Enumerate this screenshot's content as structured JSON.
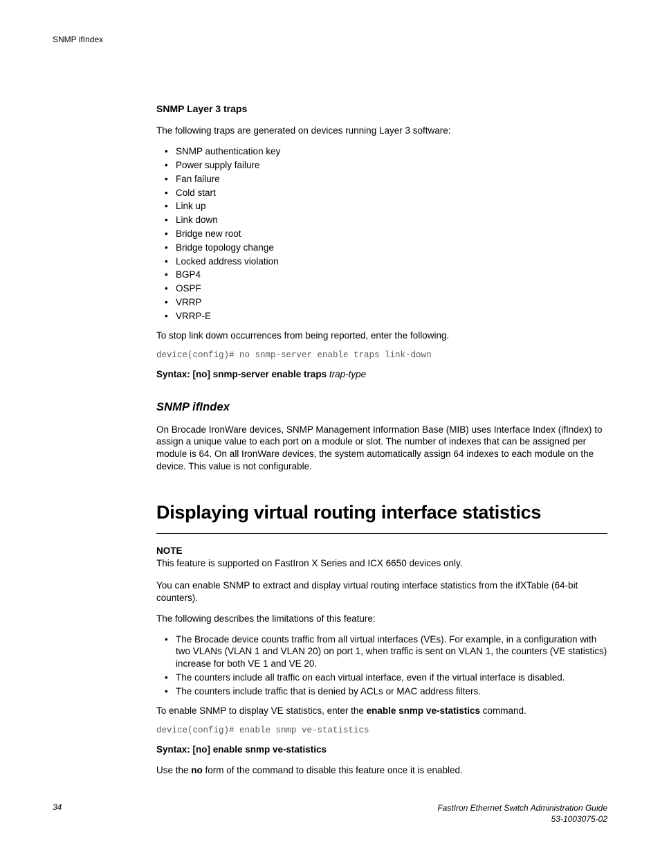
{
  "running_header": "SNMP ifIndex",
  "section1": {
    "heading": "SNMP Layer 3 traps",
    "intro": "The following traps are generated on devices running Layer 3 software:",
    "bullets": [
      "SNMP authentication key",
      "Power supply failure",
      "Fan failure",
      "Cold start",
      "Link up",
      "Link down",
      "Bridge new root",
      "Bridge topology change",
      "Locked address violation",
      "BGP4",
      "OSPF",
      "VRRP",
      "VRRP-E"
    ],
    "text_after": "To stop link down occurrences from being reported, enter the following.",
    "cli": "device(config)# no snmp-server enable traps link-down",
    "syntax_bold": "Syntax: [no] snmp-server enable traps",
    "syntax_ital": "trap-type"
  },
  "section2": {
    "heading": "SNMP ifIndex",
    "para": "On Brocade IronWare devices, SNMP Management Information Base (MIB) uses Interface Index (ifIndex) to assign a unique value to each port on a module or slot. The number of indexes that can be assigned per module is 64. On all IronWare devices, the system automatically assign 64 indexes to each module on the device. This value is not configurable."
  },
  "section3": {
    "heading": "Displaying virtual routing interface statistics",
    "note_label": "NOTE",
    "note_text": "This feature is supported on FastIron X Series and ICX 6650 devices only.",
    "para1": "You can enable SNMP to extract and display virtual routing interface statistics from the ifXTable (64-bit counters).",
    "para2": "The following describes the limitations of this feature:",
    "bullets": [
      "The Brocade device counts traffic from all virtual interfaces (VEs). For example, in a configuration with two VLANs (VLAN 1 and VLAN 20) on port 1, when traffic is sent on VLAN 1, the counters (VE statistics) increase for both VE 1 and VE 20.",
      "The counters include all traffic on each virtual interface, even if the virtual interface is disabled.",
      "The counters include traffic that is denied by ACLs or MAC address filters."
    ],
    "para3_pre": "To enable SNMP to display VE statistics, enter the ",
    "para3_bold": "enable snmp ve-statistics",
    "para3_post": " command.",
    "cli": "device(config)# enable snmp ve-statistics",
    "syntax": "Syntax: [no] enable snmp ve-statistics",
    "para4_pre": "Use the ",
    "para4_bold": "no",
    "para4_post": " form of the command to disable this feature once it is enabled."
  },
  "footer": {
    "page": "34",
    "title": "FastIron Ethernet Switch Administration Guide",
    "docnum": "53-1003075-02"
  }
}
